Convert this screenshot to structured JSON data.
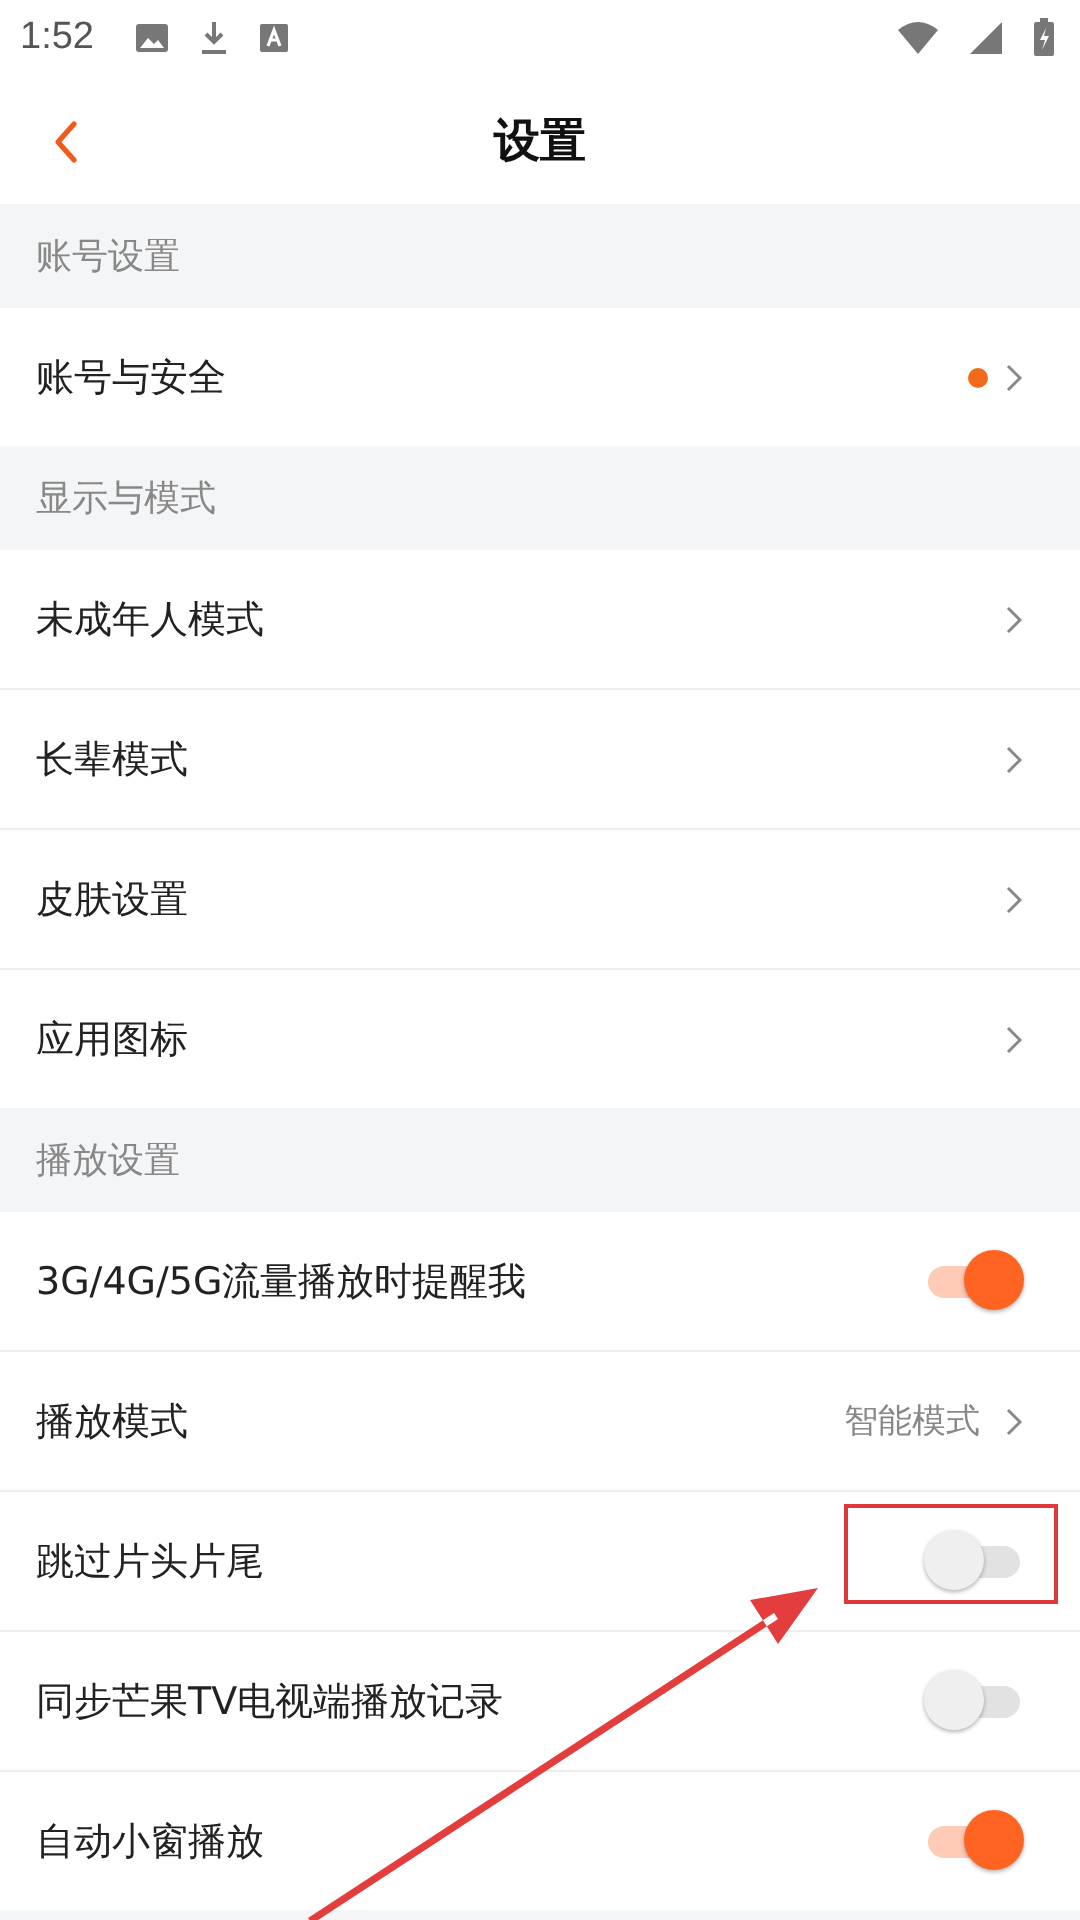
{
  "status_bar": {
    "time": "1:52"
  },
  "header": {
    "title": "设置"
  },
  "sections": [
    {
      "title": "账号设置",
      "items": [
        {
          "kind": "link",
          "label": "账号与安全",
          "dot": true
        }
      ]
    },
    {
      "title": "显示与模式",
      "items": [
        {
          "kind": "link",
          "label": "未成年人模式"
        },
        {
          "kind": "link",
          "label": "长辈模式"
        },
        {
          "kind": "link",
          "label": "皮肤设置"
        },
        {
          "kind": "link",
          "label": "应用图标"
        }
      ]
    },
    {
      "title": "播放设置",
      "items": [
        {
          "kind": "toggle",
          "label": "3G/4G/5G流量播放时提醒我",
          "on": true
        },
        {
          "kind": "link",
          "label": "播放模式",
          "value": "智能模式"
        },
        {
          "kind": "toggle",
          "label": "跳过片头片尾",
          "on": false,
          "highlighted": true
        },
        {
          "kind": "toggle",
          "label": "同步芒果TV电视端播放记录",
          "on": false
        },
        {
          "kind": "toggle",
          "label": "自动小窗播放",
          "on": true
        }
      ]
    }
  ]
}
